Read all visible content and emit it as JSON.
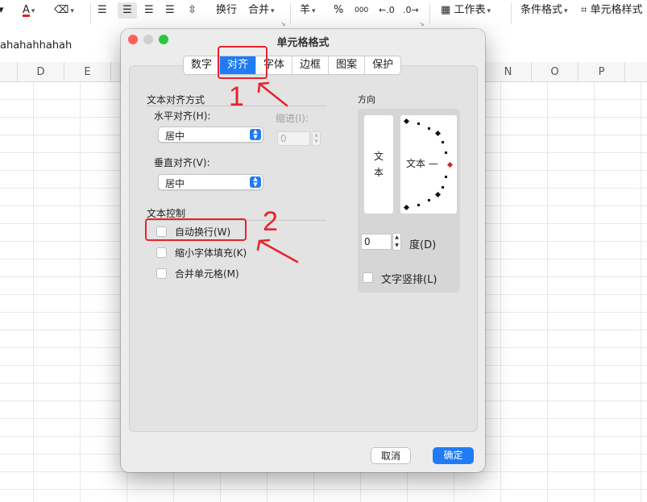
{
  "toolbar": {
    "font_color_icon": "A",
    "wrap_text": "换行",
    "merge": "合并",
    "currency": "羊",
    "percent": "%",
    "thousands": "000",
    "worksheet": "工作表",
    "conditional_format": "条件格式",
    "cell_style": "单元格样式"
  },
  "formula_bar": {
    "value": "ahahahhahah"
  },
  "columns": [
    "D",
    "E",
    "N",
    "O",
    "P"
  ],
  "dialog": {
    "title": "单元格格式",
    "tabs": [
      {
        "label": "数字",
        "active": false
      },
      {
        "label": "对齐",
        "active": true
      },
      {
        "label": "字体",
        "active": false
      },
      {
        "label": "边框",
        "active": false
      },
      {
        "label": "图案",
        "active": false
      },
      {
        "label": "保护",
        "active": false
      }
    ],
    "text_alignment": {
      "title": "文本对齐方式",
      "horizontal_label": "水平对齐(H):",
      "horizontal_value": "居中",
      "indent_label": "缩进(I):",
      "indent_value": "0",
      "vertical_label": "垂直对齐(V):",
      "vertical_value": "居中"
    },
    "text_control": {
      "title": "文本控制",
      "options": [
        {
          "label": "自动换行(W)",
          "checked": false
        },
        {
          "label": "缩小字体填充(K)",
          "checked": false
        },
        {
          "label": "合并单元格(M)",
          "checked": false
        }
      ]
    },
    "orientation": {
      "title": "方向",
      "vertical_text": [
        "文",
        "本"
      ],
      "dial_text": "文本 —",
      "degrees_value": "0",
      "degrees_label": "度(D)",
      "vertical_stack_label": "文字竖排(L)",
      "vertical_stack_checked": false
    },
    "buttons": {
      "cancel": "取消",
      "ok": "确定"
    }
  },
  "annotations": {
    "step_1": "1",
    "step_2": "2",
    "color": "#e8222a"
  },
  "colors": {
    "accent": "#1f7cf5",
    "close_light": "#fe5f57",
    "minimize_light": "#febc2e",
    "zoom_light": "#28c840"
  }
}
